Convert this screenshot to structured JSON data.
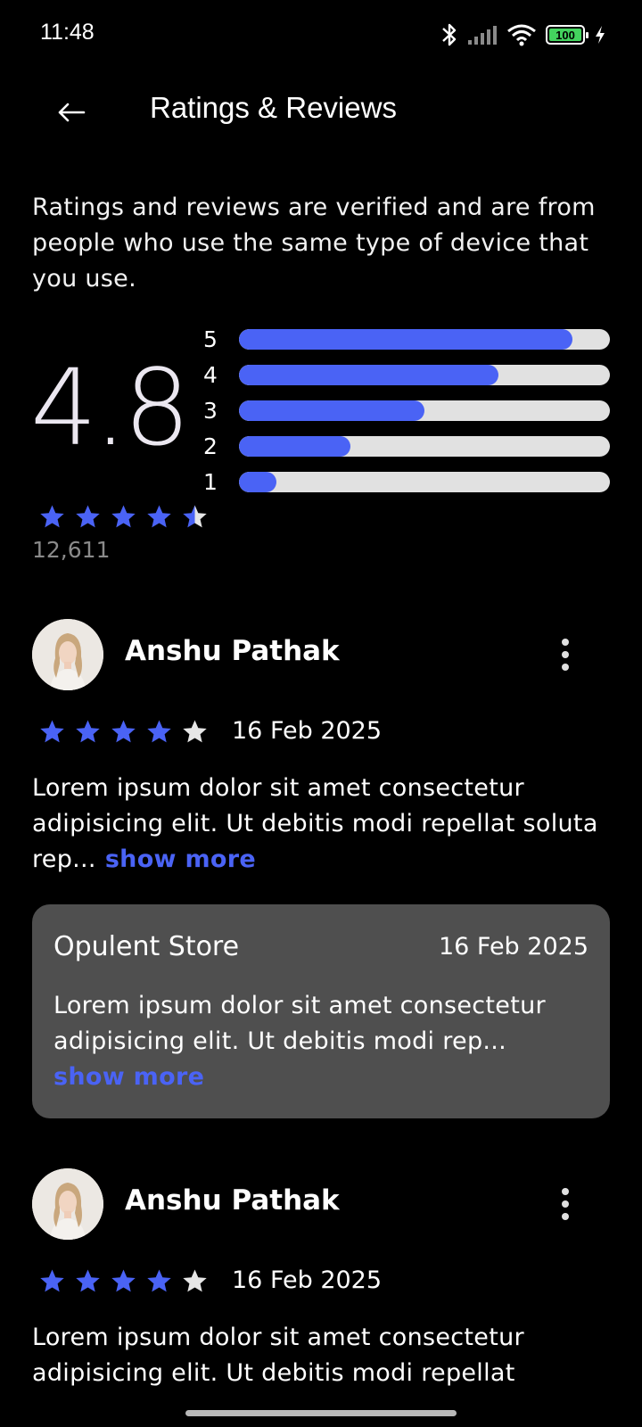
{
  "status": {
    "time": "11:48",
    "battery": "100"
  },
  "header": {
    "title": "Ratings & Reviews",
    "back_icon": "arrow-left-icon"
  },
  "intro": "Ratings and reviews are verified and are from people who use the same type of device that you use.",
  "summary": {
    "average": "4.8",
    "count": "12,611",
    "stars": 4.5,
    "distribution": [
      {
        "label": "5",
        "fraction": 0.9
      },
      {
        "label": "4",
        "fraction": 0.7
      },
      {
        "label": "3",
        "fraction": 0.5
      },
      {
        "label": "2",
        "fraction": 0.3
      },
      {
        "label": "1",
        "fraction": 0.1
      }
    ]
  },
  "reviews": [
    {
      "name": "Anshu Pathak",
      "stars": 4,
      "date": "16 Feb 2025",
      "body": "Lorem ipsum dolor sit amet consectetur adipisicing elit. Ut debitis modi repellat soluta rep...",
      "show_more": "show more",
      "reply": {
        "store": "Opulent Store",
        "date": "16 Feb 2025",
        "body": "Lorem ipsum dolor sit amet consectetur adipisicing elit. Ut debitis modi rep...",
        "show_more": "show more"
      }
    },
    {
      "name": "Anshu Pathak",
      "stars": 4,
      "date": "16 Feb 2025",
      "body": "Lorem ipsum dolor sit amet consectetur adipisicing elit. Ut debitis modi repellat"
    }
  ],
  "colors": {
    "accent": "#4a63f5",
    "star_empty": "#e6e6e6",
    "track": "#e1e1e1",
    "reply_bg": "#4f4f4f"
  }
}
